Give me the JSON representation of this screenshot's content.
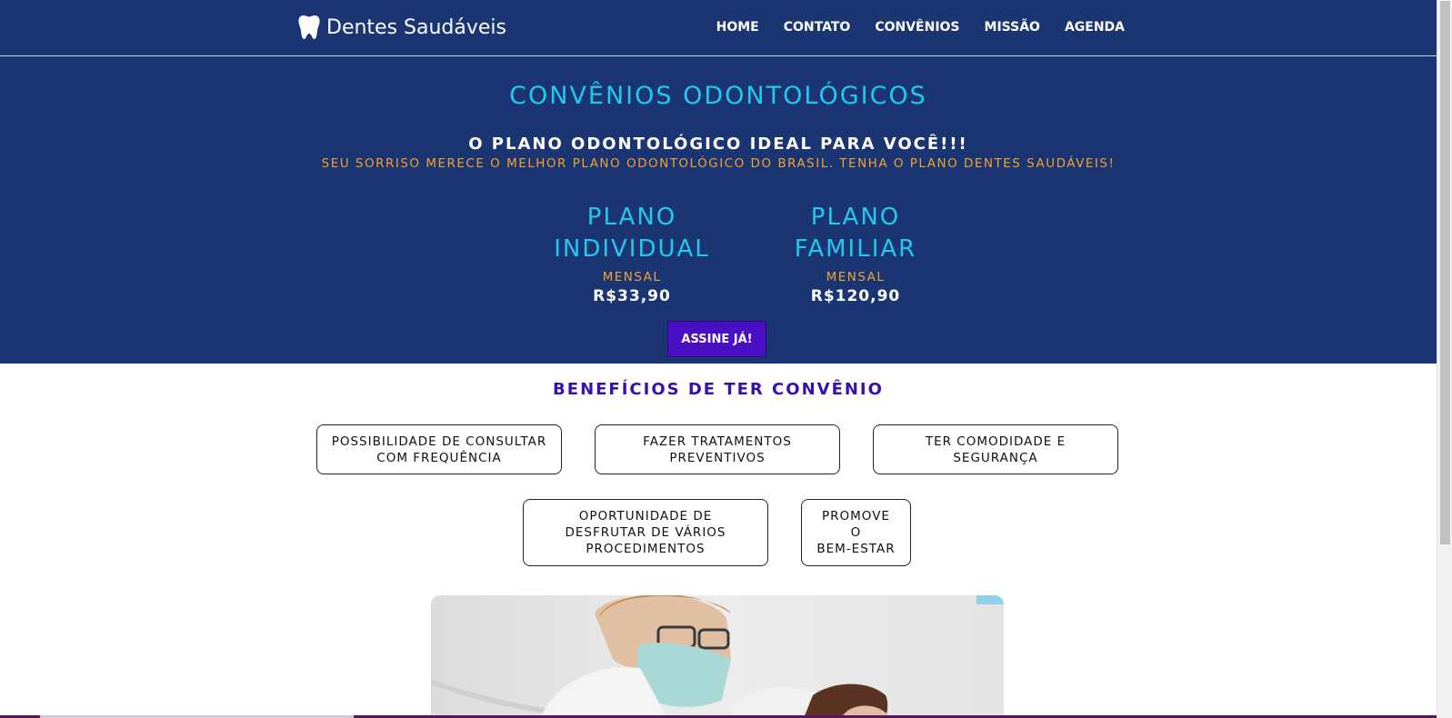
{
  "header": {
    "brand": "Dentes Saudáveis",
    "brand_icon": "tooth-icon",
    "nav": [
      "HOME",
      "CONTATO",
      "CONVÊNIOS",
      "MISSÃO",
      "AGENDA"
    ]
  },
  "hero": {
    "title": "CONVÊNIOS ODONTOLÓGICOS",
    "subtitle": "O PLANO ODONTOLÓGICO IDEAL PARA VOCÊ!!!",
    "tagline": "SEU SORRISO MERECE O MELHOR PLANO ODONTOLÓGICO DO BRASIL. TENHA O PLANO DENTES SAUDÁVEIS!",
    "plans": [
      {
        "line1": "PLANO",
        "line2": "INDIVIDUAL",
        "period": "MENSAL",
        "price": "R$33,90"
      },
      {
        "line1": "PLANO",
        "line2": "FAMILIAR",
        "period": "MENSAL",
        "price": "R$120,90"
      }
    ],
    "cta": "ASSINE JÁ!"
  },
  "benefits": {
    "title": "BENEFÍCIOS DE TER CONVÊNIO",
    "items": [
      {
        "line1": "POSSIBILIDADE DE CONSULTAR",
        "line2": "COM FREQUÊNCIA"
      },
      {
        "line1": "FAZER TRATAMENTOS",
        "line2": "PREVENTIVOS"
      },
      {
        "line1": "TER COMODIDADE E",
        "line2": "SEGURANÇA"
      },
      {
        "line1": "OPORTUNIDADE DE",
        "line2": "DESFRUTAR DE VÁRIOS",
        "line3": "PROCEDIMENTOS"
      },
      {
        "line1": "PROMOVE",
        "line2": "O",
        "line3": "BEM-ESTAR"
      }
    ]
  },
  "colors": {
    "navy": "#1b3573",
    "cyan": "#22c8ee",
    "orange": "#f0a230",
    "purple": "#4a0fc3",
    "benefits_title": "#3a0fb2"
  }
}
